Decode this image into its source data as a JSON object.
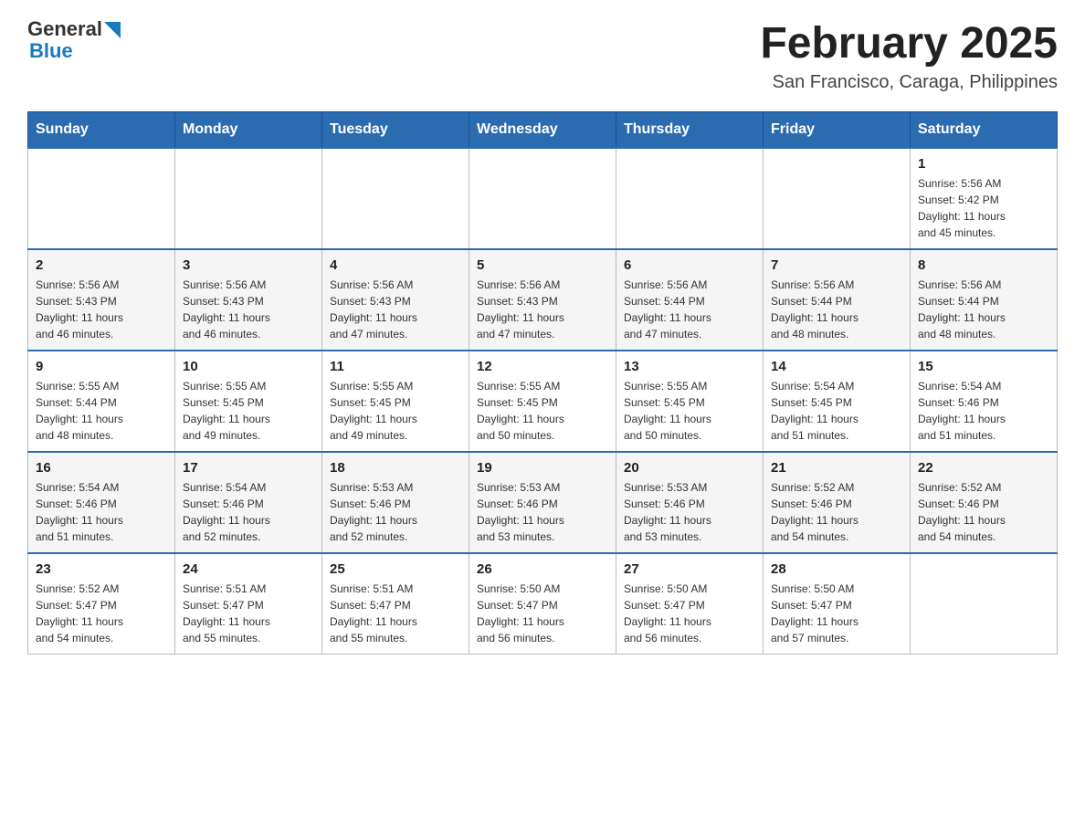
{
  "header": {
    "logo": {
      "general": "General",
      "blue": "Blue"
    },
    "title": "February 2025",
    "subtitle": "San Francisco, Caraga, Philippines"
  },
  "weekdays": [
    "Sunday",
    "Monday",
    "Tuesday",
    "Wednesday",
    "Thursday",
    "Friday",
    "Saturday"
  ],
  "weeks": [
    {
      "days": [
        {
          "num": "",
          "info": ""
        },
        {
          "num": "",
          "info": ""
        },
        {
          "num": "",
          "info": ""
        },
        {
          "num": "",
          "info": ""
        },
        {
          "num": "",
          "info": ""
        },
        {
          "num": "",
          "info": ""
        },
        {
          "num": "1",
          "info": "Sunrise: 5:56 AM\nSunset: 5:42 PM\nDaylight: 11 hours\nand 45 minutes."
        }
      ]
    },
    {
      "days": [
        {
          "num": "2",
          "info": "Sunrise: 5:56 AM\nSunset: 5:43 PM\nDaylight: 11 hours\nand 46 minutes."
        },
        {
          "num": "3",
          "info": "Sunrise: 5:56 AM\nSunset: 5:43 PM\nDaylight: 11 hours\nand 46 minutes."
        },
        {
          "num": "4",
          "info": "Sunrise: 5:56 AM\nSunset: 5:43 PM\nDaylight: 11 hours\nand 47 minutes."
        },
        {
          "num": "5",
          "info": "Sunrise: 5:56 AM\nSunset: 5:43 PM\nDaylight: 11 hours\nand 47 minutes."
        },
        {
          "num": "6",
          "info": "Sunrise: 5:56 AM\nSunset: 5:44 PM\nDaylight: 11 hours\nand 47 minutes."
        },
        {
          "num": "7",
          "info": "Sunrise: 5:56 AM\nSunset: 5:44 PM\nDaylight: 11 hours\nand 48 minutes."
        },
        {
          "num": "8",
          "info": "Sunrise: 5:56 AM\nSunset: 5:44 PM\nDaylight: 11 hours\nand 48 minutes."
        }
      ]
    },
    {
      "days": [
        {
          "num": "9",
          "info": "Sunrise: 5:55 AM\nSunset: 5:44 PM\nDaylight: 11 hours\nand 48 minutes."
        },
        {
          "num": "10",
          "info": "Sunrise: 5:55 AM\nSunset: 5:45 PM\nDaylight: 11 hours\nand 49 minutes."
        },
        {
          "num": "11",
          "info": "Sunrise: 5:55 AM\nSunset: 5:45 PM\nDaylight: 11 hours\nand 49 minutes."
        },
        {
          "num": "12",
          "info": "Sunrise: 5:55 AM\nSunset: 5:45 PM\nDaylight: 11 hours\nand 50 minutes."
        },
        {
          "num": "13",
          "info": "Sunrise: 5:55 AM\nSunset: 5:45 PM\nDaylight: 11 hours\nand 50 minutes."
        },
        {
          "num": "14",
          "info": "Sunrise: 5:54 AM\nSunset: 5:45 PM\nDaylight: 11 hours\nand 51 minutes."
        },
        {
          "num": "15",
          "info": "Sunrise: 5:54 AM\nSunset: 5:46 PM\nDaylight: 11 hours\nand 51 minutes."
        }
      ]
    },
    {
      "days": [
        {
          "num": "16",
          "info": "Sunrise: 5:54 AM\nSunset: 5:46 PM\nDaylight: 11 hours\nand 51 minutes."
        },
        {
          "num": "17",
          "info": "Sunrise: 5:54 AM\nSunset: 5:46 PM\nDaylight: 11 hours\nand 52 minutes."
        },
        {
          "num": "18",
          "info": "Sunrise: 5:53 AM\nSunset: 5:46 PM\nDaylight: 11 hours\nand 52 minutes."
        },
        {
          "num": "19",
          "info": "Sunrise: 5:53 AM\nSunset: 5:46 PM\nDaylight: 11 hours\nand 53 minutes."
        },
        {
          "num": "20",
          "info": "Sunrise: 5:53 AM\nSunset: 5:46 PM\nDaylight: 11 hours\nand 53 minutes."
        },
        {
          "num": "21",
          "info": "Sunrise: 5:52 AM\nSunset: 5:46 PM\nDaylight: 11 hours\nand 54 minutes."
        },
        {
          "num": "22",
          "info": "Sunrise: 5:52 AM\nSunset: 5:46 PM\nDaylight: 11 hours\nand 54 minutes."
        }
      ]
    },
    {
      "days": [
        {
          "num": "23",
          "info": "Sunrise: 5:52 AM\nSunset: 5:47 PM\nDaylight: 11 hours\nand 54 minutes."
        },
        {
          "num": "24",
          "info": "Sunrise: 5:51 AM\nSunset: 5:47 PM\nDaylight: 11 hours\nand 55 minutes."
        },
        {
          "num": "25",
          "info": "Sunrise: 5:51 AM\nSunset: 5:47 PM\nDaylight: 11 hours\nand 55 minutes."
        },
        {
          "num": "26",
          "info": "Sunrise: 5:50 AM\nSunset: 5:47 PM\nDaylight: 11 hours\nand 56 minutes."
        },
        {
          "num": "27",
          "info": "Sunrise: 5:50 AM\nSunset: 5:47 PM\nDaylight: 11 hours\nand 56 minutes."
        },
        {
          "num": "28",
          "info": "Sunrise: 5:50 AM\nSunset: 5:47 PM\nDaylight: 11 hours\nand 57 minutes."
        },
        {
          "num": "",
          "info": ""
        }
      ]
    }
  ]
}
